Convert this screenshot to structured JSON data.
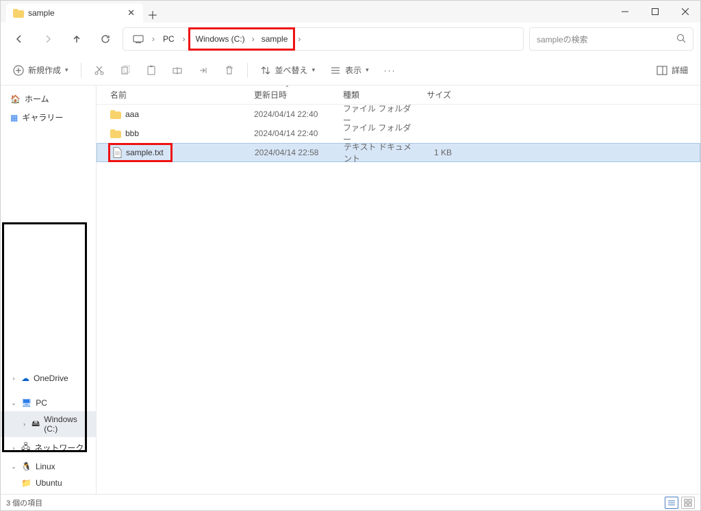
{
  "title": "sample",
  "breadcrumb": {
    "pc": "PC",
    "drive": "Windows (C:)",
    "folder": "sample"
  },
  "search": {
    "placeholder": "sampleの検索"
  },
  "toolbar": {
    "new": "新規作成",
    "sort": "並べ替え",
    "view": "表示",
    "details": "詳細"
  },
  "columns": {
    "name": "名前",
    "date": "更新日時",
    "type": "種類",
    "size": "サイズ"
  },
  "rows": [
    {
      "name": "aaa",
      "date": "2024/04/14 22:40",
      "type": "ファイル フォルダー",
      "size": "",
      "icon": "folder"
    },
    {
      "name": "bbb",
      "date": "2024/04/14 22:40",
      "type": "ファイル フォルダー",
      "size": "",
      "icon": "folder"
    },
    {
      "name": "sample.txt",
      "date": "2024/04/14 22:58",
      "type": "テキスト ドキュメント",
      "size": "1 KB",
      "icon": "file"
    }
  ],
  "sidebar": {
    "home": "ホーム",
    "gallery": "ギャラリー",
    "onedrive": "OneDrive",
    "pc": "PC",
    "drive_c": "Windows (C:)",
    "network": "ネットワーク",
    "linux": "Linux",
    "ubuntu": "Ubuntu"
  },
  "status": {
    "count": "3 個の項目"
  }
}
